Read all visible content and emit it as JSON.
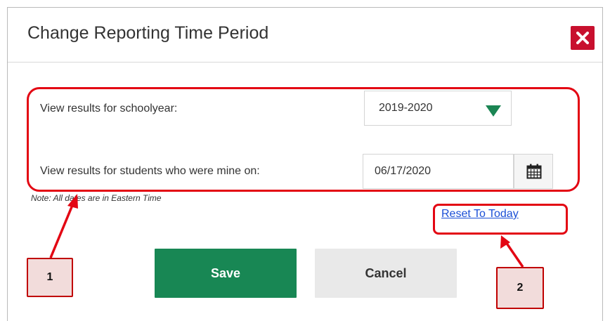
{
  "dialog": {
    "title": "Change Reporting Time Period",
    "close_icon": "close-icon"
  },
  "form": {
    "schoolyear_label": "View results for schoolyear:",
    "schoolyear_value": "2019-2020",
    "date_label": "View results for students who were mine on:",
    "date_value": "06/17/2020",
    "calendar_icon": "calendar-icon",
    "note": "Note: All dates are in Eastern Time",
    "reset_link": "Reset To Today"
  },
  "buttons": {
    "save": "Save",
    "cancel": "Cancel"
  },
  "annotations": {
    "callout_1": "1",
    "callout_2": "2",
    "highlight_color": "#e30613"
  },
  "colors": {
    "close_bg": "#c8102e",
    "save_bg": "#188754",
    "cancel_bg": "#e9e9e9",
    "dropdown_arrow": "#1b8553",
    "link": "#1a4fd6",
    "callout_bg": "#f2dcdb"
  }
}
